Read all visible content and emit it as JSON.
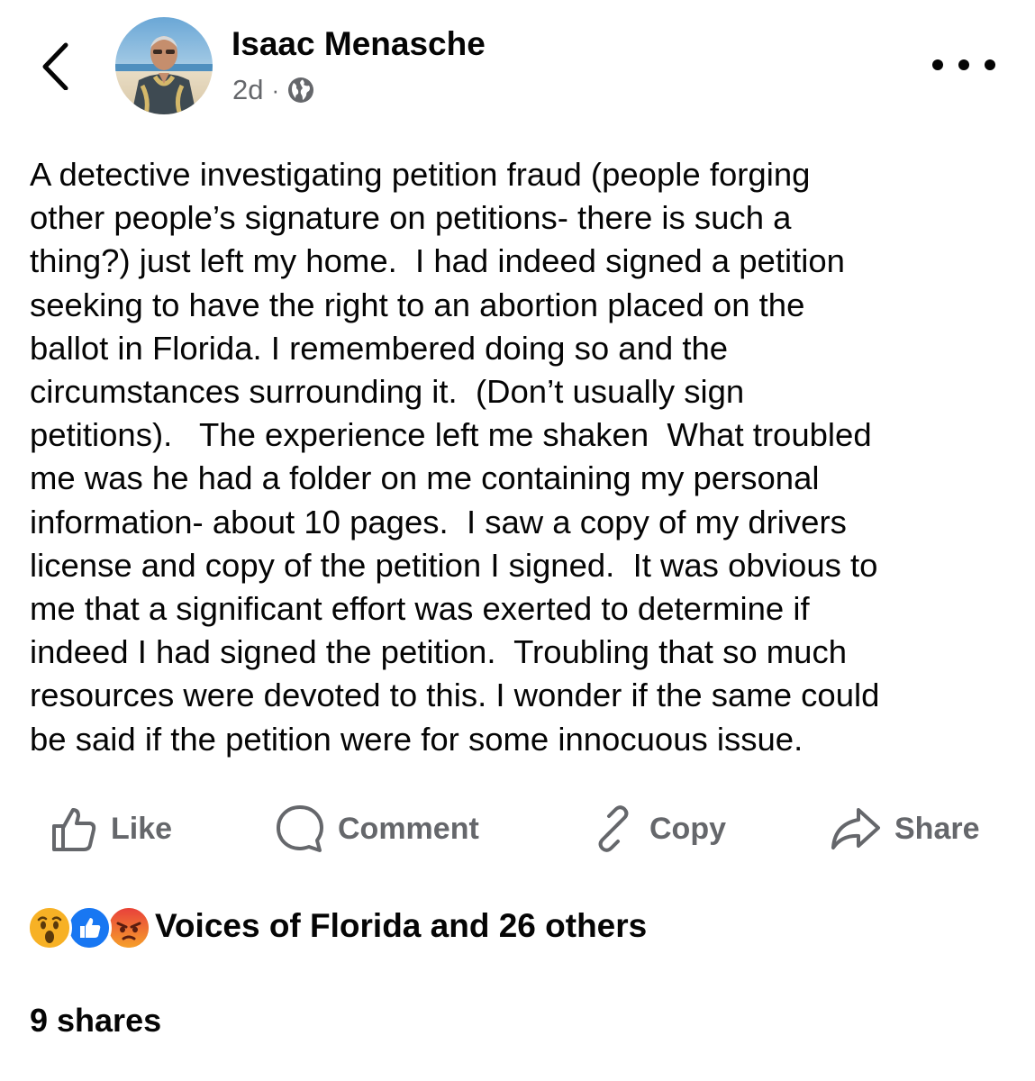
{
  "post": {
    "author": "Isaac Menasche",
    "time": "2d",
    "separator": "·",
    "text": "A detective investigating petition fraud (people forging\nother people’s signature on petitions- there is such a\nthing?) just left my home.  I had indeed signed a petition\nseeking to have the right to an abortion placed on the\nballot in Florida. I remembered doing so and the\ncircumstances surrounding it.  (Don’t usually sign\npetitions).   The experience left me shaken  What troubled\nme was he had a folder on me containing my personal\ninformation- about 10 pages.  I saw a copy of my drivers\nlicense and copy of the petition I signed.  It was obvious to\nme that a significant effort was exerted to determine if\nindeed I had signed the petition.  Troubling that so much\nresources were devoted to this. I wonder if the same could\nbe said if the petition were for some innocuous issue."
  },
  "actions": {
    "like": "Like",
    "comment": "Comment",
    "copy": "Copy",
    "share": "Share"
  },
  "reactions": {
    "icons": [
      "wow-icon",
      "like-icon",
      "angry-icon"
    ],
    "summary": "Voices of Florida and 26 others"
  },
  "shares": "9 shares",
  "colors": {
    "text": "#050505",
    "secondary": "#65676b",
    "like_blue": "#1877f2",
    "wow_yellow": "#f7b125",
    "angry_red": "#e9710f"
  }
}
